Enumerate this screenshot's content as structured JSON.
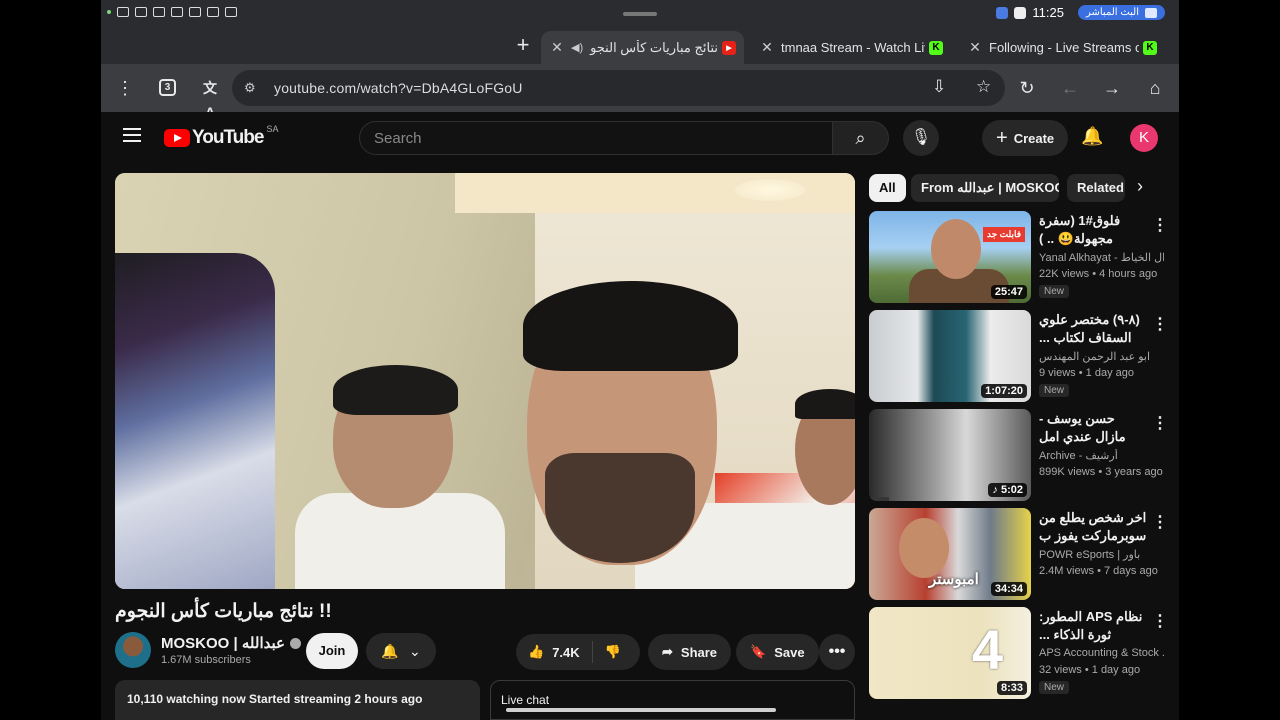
{
  "status_bar": {
    "time": "11:25",
    "live_pill": "البث المباشر"
  },
  "tabs": [
    {
      "title": "نتائج مباريات كأس النجوم !! - YouTube",
      "favicon": "youtube-favicon",
      "active": true,
      "audio": true
    },
    {
      "title": "tmnaa Stream - Watch Live",
      "favicon": "kick-favicon",
      "active": false
    },
    {
      "title": "Following - Live Streams on",
      "favicon": "kick-favicon",
      "active": false
    }
  ],
  "toolbar": {
    "url": "youtube.com/watch?v=DbA4GLoFGoU",
    "tab_count": "3"
  },
  "masthead": {
    "logo_text": "YouTube",
    "region": "SA",
    "search_placeholder": "Search",
    "create_label": "Create",
    "avatar_letter": "K"
  },
  "video": {
    "title": "نتائج مباريات كأس النجوم !!",
    "channel": "MOSKOO | عبدالله",
    "subscribers": "1.67M subscribers",
    "join_label": "Join",
    "likes": "7.4K",
    "share_label": "Share",
    "save_label": "Save",
    "watching": "10,110 watching now  Started streaming 2 hours ago",
    "live_chat": "Live chat"
  },
  "chips": [
    "All",
    "From عبدالله | MOSKOO",
    "Related"
  ],
  "recommendations": [
    {
      "title": "فلوق#1 (سفرة مجهولة😃 .. )",
      "channel": "Yanal Alkhayat - ال الخياط",
      "views": "22K views",
      "age": "4 hours ago",
      "duration": "25:47",
      "badge": "New",
      "thumb_text": "فابلت جد"
    },
    {
      "title": "(٨-٩) مختصر علوي السقاف لكتاب ...",
      "channel": "ابو عبد الرحمن المهندس",
      "views": "9 views",
      "age": "1 day ago",
      "duration": "1:07:20",
      "badge": "New"
    },
    {
      "title": "حسن يوسف - مازال عندي امل",
      "channel": "Archive - أرشيف",
      "views": "899K views",
      "age": "3 years ago",
      "duration": "5:02"
    },
    {
      "title": "اخر شخص يطلع من سوبرماركت يفوز ب ...",
      "channel": "POWR eSports | باور",
      "views": "2.4M views",
      "age": "7 days ago",
      "duration": "34:34",
      "thumb_text": "امبوستر"
    },
    {
      "title": "نظام APS المطور: ثورة الذكاء ...",
      "channel": "APS Accounting & Stock ...",
      "views": "32 views",
      "age": "1 day ago",
      "duration": "8:33",
      "badge": "New",
      "thumb_text": "4"
    }
  ],
  "colors": {
    "yt_red": "#ff0000",
    "bg": "#0f0f0f",
    "chip": "#272727",
    "avatar": "#e9376f",
    "kick": "#53fc18"
  }
}
